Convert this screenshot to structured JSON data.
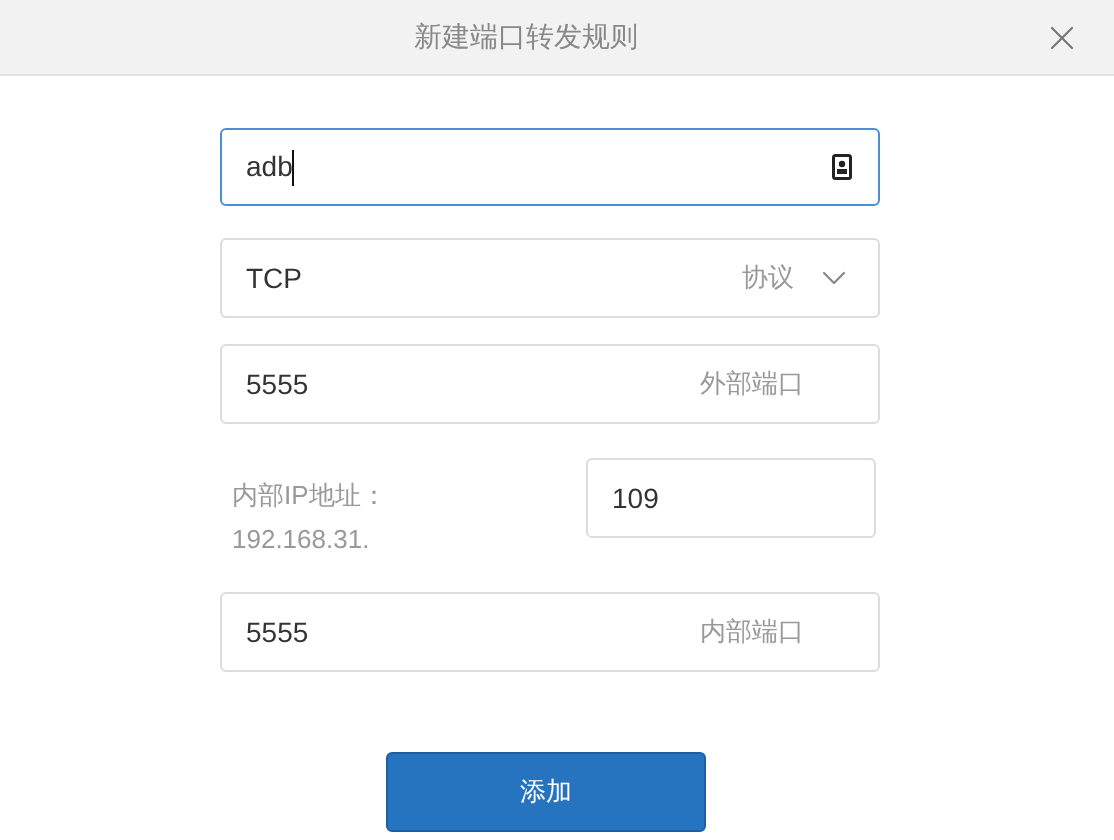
{
  "dialog": {
    "title": "新建端口转发规则"
  },
  "name_field": {
    "value": "adb",
    "focused": true
  },
  "protocol": {
    "value": "TCP",
    "label": "协议"
  },
  "external_port": {
    "value": "5555",
    "label": "外部端口"
  },
  "internal_ip": {
    "label": "内部IP地址：",
    "prefix": "192.168.31.",
    "value": "109"
  },
  "internal_port": {
    "value": "5555",
    "label": "内部端口"
  },
  "submit": {
    "label": "添加"
  }
}
